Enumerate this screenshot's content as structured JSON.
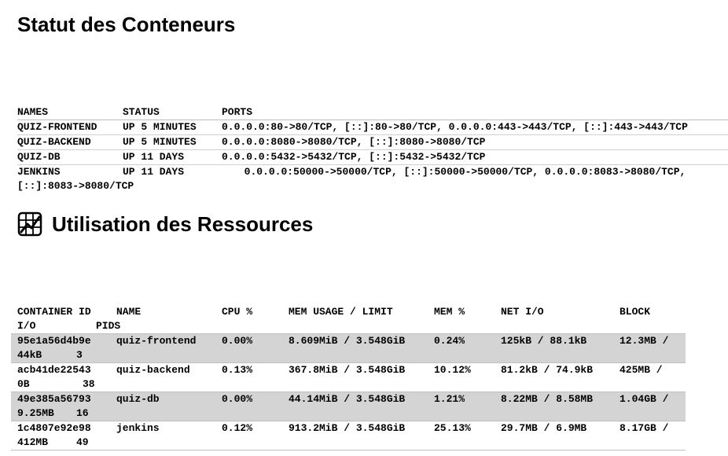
{
  "containers": {
    "title": "Statut des Conteneurs",
    "headers": {
      "names": "NAMES",
      "status": "STATUS",
      "ports": "PORTS"
    },
    "rows": [
      {
        "name": "QUIZ-FRONTEND",
        "status": "UP 5 MINUTES",
        "ports": "0.0.0.0:80->80/TCP, [::]:80->80/TCP, 0.0.0.0:443->443/TCP, [::]:443->443/TCP"
      },
      {
        "name": "QUIZ-BACKEND",
        "status": "UP 5 MINUTES",
        "ports": "0.0.0.0:8080->8080/TCP, [::]:8080->8080/TCP"
      },
      {
        "name": "QUIZ-DB",
        "status": "UP 11 DAYS",
        "ports": "0.0.0.0:5432->5432/TCP, [::]:5432->5432/TCP"
      },
      {
        "name": "JENKINS",
        "status": "UP 11 DAYS",
        "ports": "0.0.0.0:50000->50000/TCP, [::]:50000->50000/TCP, 0.0.0.0:8083->8080/TCP, [::]:8083->8080/TCP"
      }
    ]
  },
  "resources": {
    "title": "Utilisation des Ressources",
    "icon": "chart-icon",
    "headers": {
      "container_id": "CONTAINER ID",
      "name": "NAME",
      "cpu": "CPU %",
      "mem_usage": "MEM USAGE / LIMIT",
      "mem_pct": "MEM %",
      "net_io": "NET I/O",
      "block_a": "BLOCK",
      "block_b": "I/O",
      "pids": "PIDS"
    },
    "rows": [
      {
        "id": "95e1a56d4b9e",
        "name": "quiz-frontend",
        "cpu": "0.00%",
        "mem": "8.609MiB / 3.548GiB",
        "mem_pct": "0.24%",
        "net": "125kB / 88.1kB",
        "block_a": "12.3MB /",
        "block_b": "44kB",
        "pids": "3"
      },
      {
        "id": "acb41de22543",
        "name": "quiz-backend",
        "cpu": "0.13%",
        "mem": "367.8MiB / 3.548GiB",
        "mem_pct": "10.12%",
        "net": "81.2kB / 74.9kB",
        "block_a": "425MB /",
        "block_b": "0B",
        "pids": "38"
      },
      {
        "id": "49e385a56793",
        "name": "quiz-db",
        "cpu": "0.00%",
        "mem": "44.14MiB / 3.548GiB",
        "mem_pct": "1.21%",
        "net": "8.22MB / 8.58MB",
        "block_a": "1.04GB /",
        "block_b": "9.25MB",
        "pids": "16"
      },
      {
        "id": "1c4807e92e98",
        "name": "jenkins",
        "cpu": "0.12%",
        "mem": "913.2MiB / 3.548GiB",
        "mem_pct": "25.13%",
        "net": "29.7MB / 6.9MB",
        "block_a": "8.17GB /",
        "block_b": "412MB",
        "pids": "49"
      }
    ]
  }
}
